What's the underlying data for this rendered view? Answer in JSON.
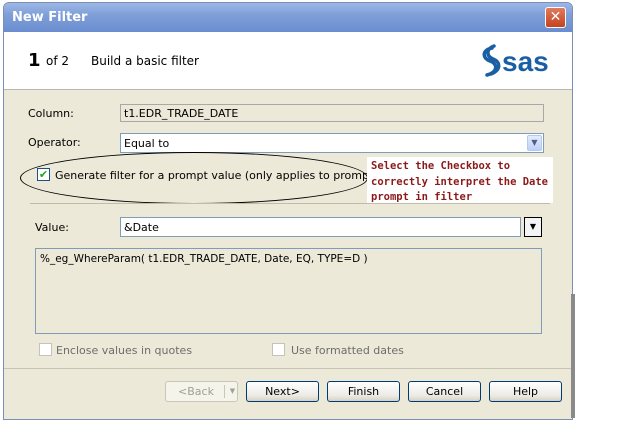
{
  "window": {
    "title": "New Filter",
    "close_glyph": "✕"
  },
  "header": {
    "step_current": "1",
    "step_of": "of 2",
    "step_title": "Build a basic filter",
    "logo_text": "sas",
    "logo_color": "#1a5fa3"
  },
  "form": {
    "column_label": "Column:",
    "column_value": "t1.EDR_TRADE_DATE",
    "operator_label": "Operator:",
    "operator_value": "Equal to",
    "prompt_checkbox_label": "Generate filter for a prompt value (only applies to prompt types)",
    "prompt_checkbox_checked": true,
    "value_label": "Value:",
    "value_value": "&Date",
    "expression": "%_eg_WhereParam( t1.EDR_TRADE_DATE, Date, EQ, TYPE=D )",
    "enclose_quotes_label": "Enclose values in quotes",
    "formatted_dates_label": "Use formatted dates"
  },
  "annotation": {
    "line1": "Select the Checkbox to",
    "line2": "correctly interpret the Date",
    "line3": "prompt in filter",
    "color": "#8b1a1a"
  },
  "buttons": {
    "back": "<Back",
    "next": "Next>",
    "finish": "Finish",
    "cancel": "Cancel",
    "help": "Help"
  },
  "icons": {
    "dropdown": "chevron-down-icon",
    "checkmark": "checkmark-icon",
    "close": "close-icon",
    "logo": "sas-logo"
  }
}
